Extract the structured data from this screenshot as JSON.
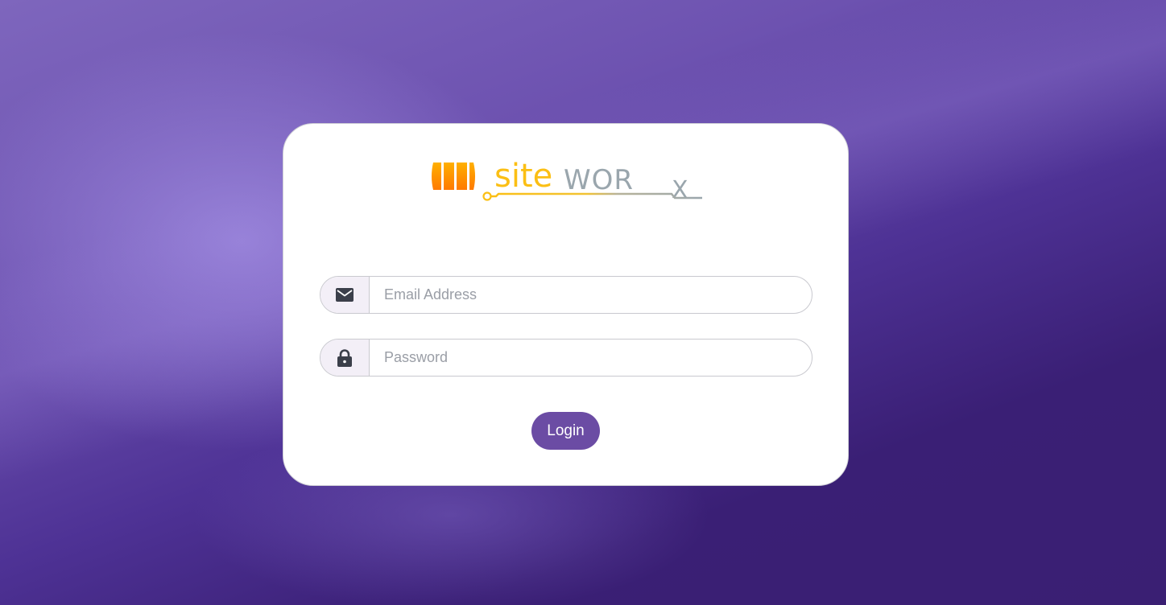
{
  "brand": {
    "logo_text_left": "site",
    "logo_text_right": "WOR",
    "logo_text_x": "X",
    "colors": {
      "orange": "#ff8a00",
      "yellow": "#fbbf14",
      "gray": "#9aa6ad"
    }
  },
  "form": {
    "email": {
      "icon": "envelope-icon",
      "placeholder": "Email Address",
      "value": ""
    },
    "password": {
      "icon": "lock-icon",
      "placeholder": "Password",
      "value": ""
    },
    "login_label": "Login"
  },
  "theme": {
    "accent": "#6b4ca4",
    "background": "#4e3295"
  }
}
